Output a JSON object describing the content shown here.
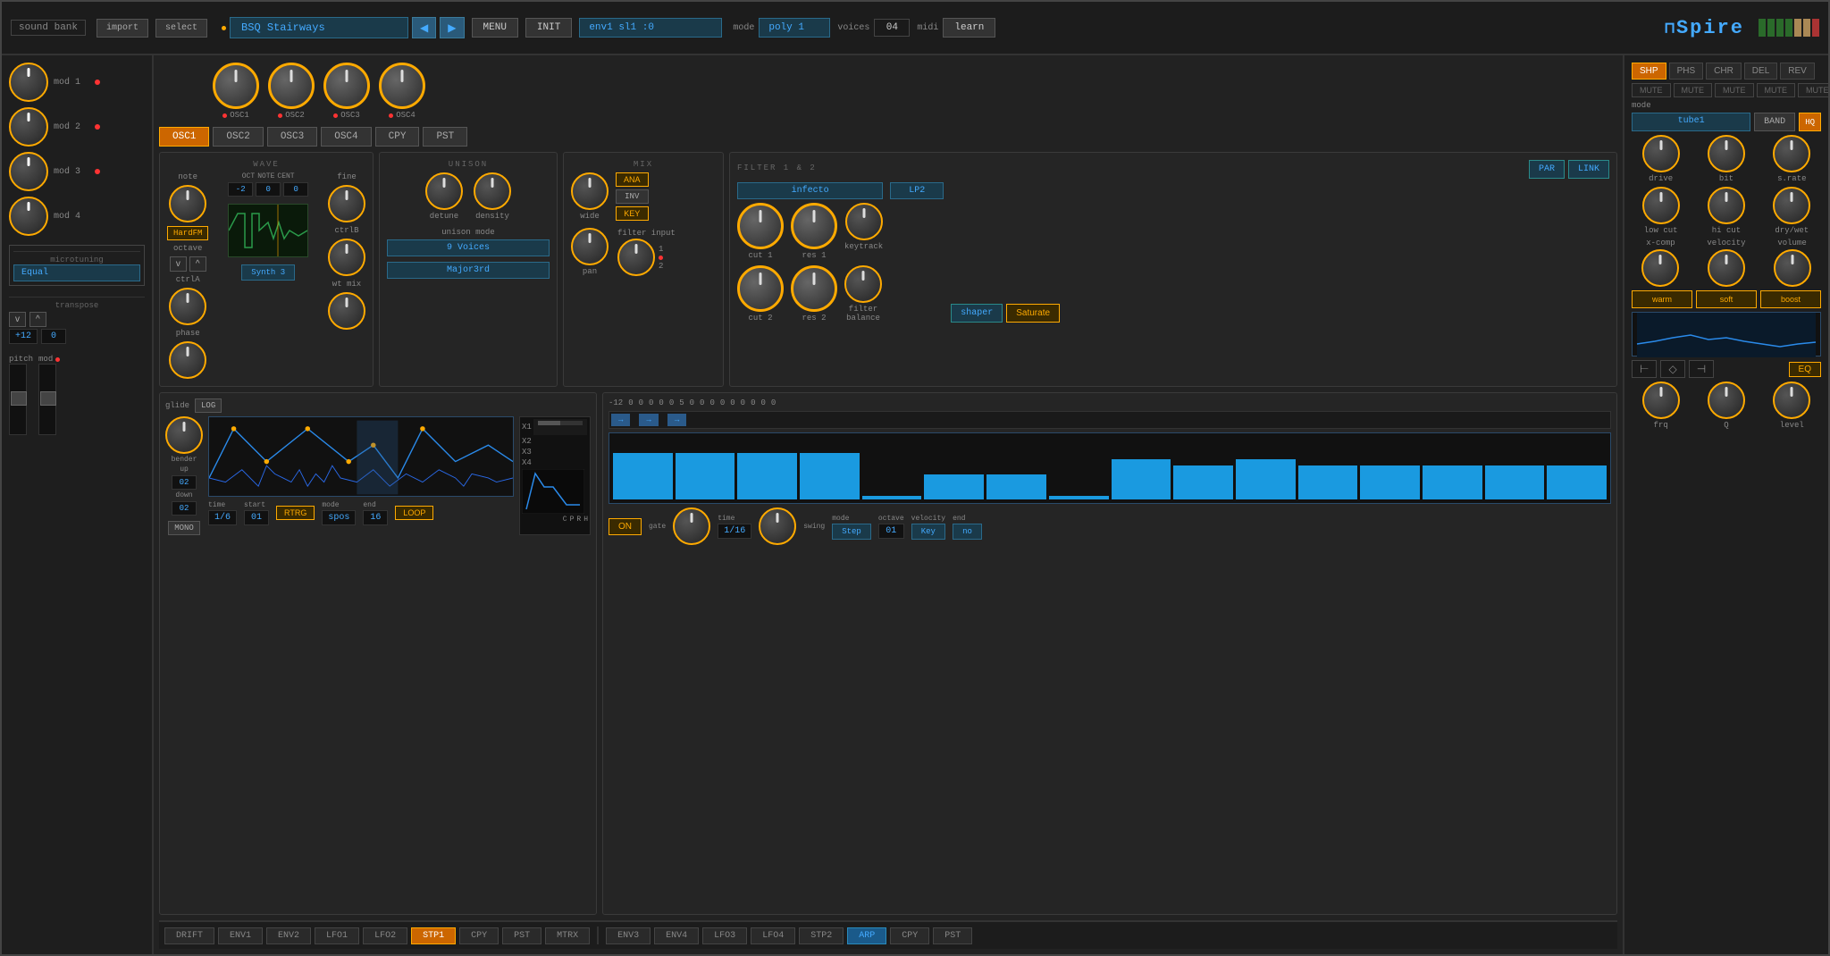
{
  "header": {
    "sound_bank": "sound bank",
    "import": "import",
    "select": "select",
    "preset_name": "BSQ Stairways",
    "menu": "MENU",
    "init": "INIT",
    "env_display": "env1 sl1   :0",
    "mode_label": "mode",
    "mode_value": "poly 1",
    "voices_label": "voices",
    "voices_value": "04",
    "midi_label": "midi",
    "midi_value": "learn",
    "logo": "Spire"
  },
  "left_sidebar": {
    "mod1": "mod 1",
    "mod2": "mod 2",
    "mod3": "mod 3",
    "mod4": "mod 4",
    "microtuning": "microtuning",
    "tuning_value": "Equal",
    "transpose": "transpose",
    "transpose_up": "^",
    "transpose_down": "v",
    "transpose_val1": "+12",
    "transpose_val2": "0",
    "pitch": "pitch",
    "mod_label": "mod"
  },
  "osc_tabs": {
    "osc1": "OSC1",
    "osc2": "OSC2",
    "osc3": "OSC3",
    "osc4": "OSC4",
    "cpy": "CPY",
    "pst": "PST"
  },
  "osc1_panel": {
    "title": "WAVE",
    "note": "note",
    "hardFM": "HardFM",
    "octave": "octave",
    "down": "v",
    "up": "^",
    "fine": "fine",
    "ctrlA": "ctrlA",
    "ctrlB": "ctrlB",
    "wt_mix": "wt mix",
    "synth3": "Synth 3",
    "oct": "OCT",
    "note_label": "NOTE",
    "cent": "CENT",
    "oct_val": "-2",
    "note_val": "0",
    "cent_val": "0",
    "phase": "phase"
  },
  "unison_panel": {
    "title": "UNISON",
    "detune": "detune",
    "density": "density",
    "unison_mode": "unison mode",
    "voices_9": "9 Voices",
    "chord": "Major3rd"
  },
  "mix_panel": {
    "title": "MIX",
    "wide": "wide",
    "ana": "ANA",
    "inv": "INV",
    "key": "KEY",
    "pan": "pan",
    "filter_input": "filter input",
    "val1": "1",
    "val2": "2"
  },
  "filter_panel": {
    "title": "FILTER 1 & 2",
    "par": "PAR",
    "link": "LINK",
    "infecto": "infecto",
    "lp2": "LP2",
    "cut1": "cut 1",
    "res1": "res 1",
    "keytrack": "keytrack",
    "cut2": "cut 2",
    "res2": "res 2",
    "filter_balance": "filter\nbalance",
    "shaper": "shaper",
    "saturate": "Saturate"
  },
  "right_panel": {
    "tabs": [
      "SHP",
      "PHS",
      "CHR",
      "DEL",
      "REV"
    ],
    "mute_labels": [
      "MUTE",
      "MUTE",
      "MUTE",
      "MUTE",
      "MUTE"
    ],
    "mode": "mode",
    "tube1": "tube1",
    "band": "BAND",
    "hq": "HQ",
    "drive": "drive",
    "bit": "bit",
    "s_rate": "s.rate",
    "low_cut": "low cut",
    "hi_cut": "hi cut",
    "dry_wet": "dry/wet",
    "x_comp": "x-comp",
    "velocity": "velocity",
    "volume": "volume",
    "warm": "warm",
    "soft": "soft",
    "boost": "boost",
    "frq": "frq",
    "q_label": "Q",
    "level": "level",
    "eq": "EQ"
  },
  "bottom_env": {
    "glide": "glide",
    "log_btn": "LOG",
    "mono_btn": "MONO",
    "bender_up": "bender\nup",
    "bender_down": "down",
    "bender_up_val": "02",
    "bender_down_val": "02",
    "time": "time",
    "time_val": "1/6",
    "start": "start",
    "start_val": "01",
    "rtrg": "RTRG",
    "mode": "mode",
    "mode_val": "spos",
    "end": "end",
    "end_val": "16",
    "loop": "LOOP",
    "x1": "X1",
    "x2": "X2",
    "x3": "X3",
    "x4": "X4",
    "c": "C",
    "p": "P",
    "r": "R",
    "h": "H"
  },
  "bottom_tabs_left": [
    "DRIFT",
    "ENV1",
    "ENV2",
    "LFO1",
    "LFO2",
    "STP1",
    "CPY",
    "PST",
    "MTRX"
  ],
  "bottom_tabs_right": [
    "ENV3",
    "ENV4",
    "LFO3",
    "LFO4",
    "STP2",
    "ARP",
    "CPY",
    "PST"
  ],
  "arp_panel": {
    "on": "ON",
    "gate": "gate",
    "time_label": "time",
    "time_val": "1/16",
    "swing": "swing",
    "mode": "mode",
    "mode_val": "Step",
    "octave": "octave",
    "octave_val": "01",
    "velocity": "velocity",
    "velocity_val": "Key",
    "end": "end",
    "end_val": "no",
    "values": [
      "-12",
      "0",
      "0",
      "0",
      "0",
      "0",
      "5",
      "0",
      "0",
      "0",
      "0",
      "0",
      "0",
      "0",
      "0",
      "0"
    ]
  },
  "osc_knobs": {
    "labels": [
      "OSC1",
      "OSC2",
      "OSC3",
      "OSC4"
    ]
  }
}
